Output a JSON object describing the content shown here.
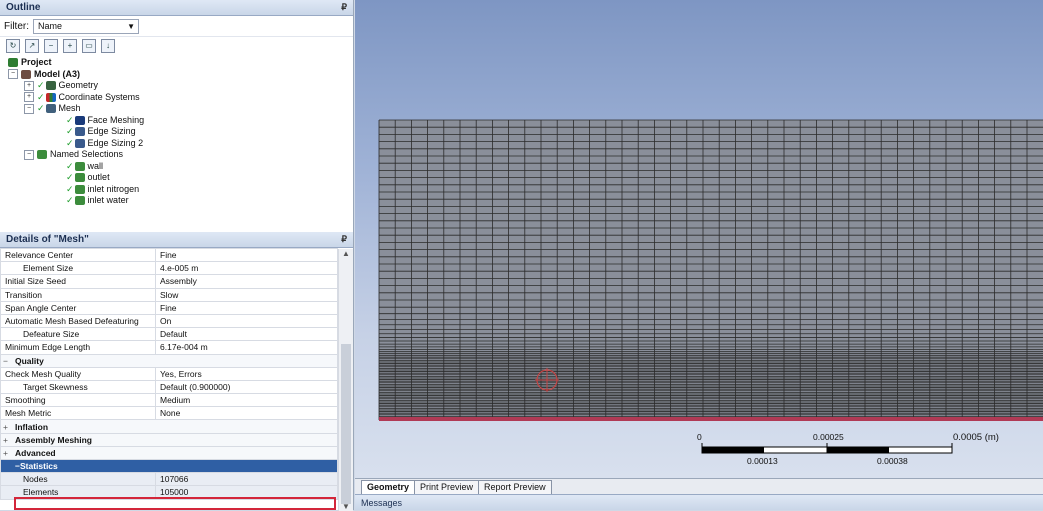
{
  "outline": {
    "title": "Outline",
    "filter_label": "Filter:",
    "filter_value": "Name",
    "tree": {
      "project": "Project",
      "model": "Model (A3)",
      "geometry": "Geometry",
      "coordinate_systems": "Coordinate Systems",
      "mesh": "Mesh",
      "face_meshing": "Face Meshing",
      "edge_sizing": "Edge Sizing",
      "edge_sizing_2": "Edge Sizing 2",
      "named_selections": "Named Selections",
      "wall": "wall",
      "outlet": "outlet",
      "inlet_nitrogen": "inlet nitrogen",
      "inlet_water": "inlet water"
    }
  },
  "details": {
    "title": "Details of \"Mesh\"",
    "rows": [
      {
        "label": "Relevance Center",
        "value": "Fine"
      },
      {
        "label": "Element Size",
        "value": "4.e-005 m"
      },
      {
        "label": "Initial Size Seed",
        "value": "Assembly"
      },
      {
        "label": "Transition",
        "value": "Slow"
      },
      {
        "label": "Span Angle Center",
        "value": "Fine"
      },
      {
        "label": "Automatic Mesh Based Defeaturing",
        "value": "On"
      },
      {
        "label": "Defeature Size",
        "value": "Default"
      },
      {
        "label": "Minimum Edge Length",
        "value": "6.17e-004 m"
      }
    ],
    "quality_group": "Quality",
    "quality_rows": [
      {
        "label": "Check Mesh Quality",
        "value": "Yes, Errors"
      },
      {
        "label": "Target Skewness",
        "value": "Default (0.900000)"
      },
      {
        "label": "Smoothing",
        "value": "Medium"
      },
      {
        "label": "Mesh Metric",
        "value": "None"
      }
    ],
    "inflation_group": "Inflation",
    "assembly_group": "Assembly Meshing",
    "advanced_group": "Advanced",
    "statistics_group": "Statistics",
    "nodes_label": "Nodes",
    "nodes_value": "107066",
    "elements_label": "Elements",
    "elements_value": "105000"
  },
  "scale": {
    "t0": "0",
    "t1": "0.00025",
    "t2": "0.0005 (m)",
    "t3": "0.00013",
    "t4": "0.00038"
  },
  "tabs": [
    "Geometry",
    "Print Preview",
    "Report Preview"
  ],
  "messages_title": "Messages",
  "colors": {
    "mesh_line": "#2b2b2b",
    "bottom_boundary": "#b03a55",
    "selection": "#d3263a"
  }
}
